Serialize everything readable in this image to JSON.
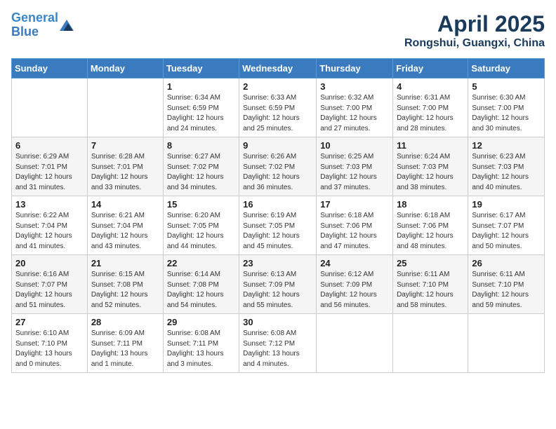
{
  "header": {
    "logo_line1": "General",
    "logo_line2": "Blue",
    "month_title": "April 2025",
    "location": "Rongshui, Guangxi, China"
  },
  "weekdays": [
    "Sunday",
    "Monday",
    "Tuesday",
    "Wednesday",
    "Thursday",
    "Friday",
    "Saturday"
  ],
  "weeks": [
    [
      {
        "day": "",
        "content": ""
      },
      {
        "day": "",
        "content": ""
      },
      {
        "day": "1",
        "content": "Sunrise: 6:34 AM\nSunset: 6:59 PM\nDaylight: 12 hours and 24 minutes."
      },
      {
        "day": "2",
        "content": "Sunrise: 6:33 AM\nSunset: 6:59 PM\nDaylight: 12 hours and 25 minutes."
      },
      {
        "day": "3",
        "content": "Sunrise: 6:32 AM\nSunset: 7:00 PM\nDaylight: 12 hours and 27 minutes."
      },
      {
        "day": "4",
        "content": "Sunrise: 6:31 AM\nSunset: 7:00 PM\nDaylight: 12 hours and 28 minutes."
      },
      {
        "day": "5",
        "content": "Sunrise: 6:30 AM\nSunset: 7:00 PM\nDaylight: 12 hours and 30 minutes."
      }
    ],
    [
      {
        "day": "6",
        "content": "Sunrise: 6:29 AM\nSunset: 7:01 PM\nDaylight: 12 hours and 31 minutes."
      },
      {
        "day": "7",
        "content": "Sunrise: 6:28 AM\nSunset: 7:01 PM\nDaylight: 12 hours and 33 minutes."
      },
      {
        "day": "8",
        "content": "Sunrise: 6:27 AM\nSunset: 7:02 PM\nDaylight: 12 hours and 34 minutes."
      },
      {
        "day": "9",
        "content": "Sunrise: 6:26 AM\nSunset: 7:02 PM\nDaylight: 12 hours and 36 minutes."
      },
      {
        "day": "10",
        "content": "Sunrise: 6:25 AM\nSunset: 7:03 PM\nDaylight: 12 hours and 37 minutes."
      },
      {
        "day": "11",
        "content": "Sunrise: 6:24 AM\nSunset: 7:03 PM\nDaylight: 12 hours and 38 minutes."
      },
      {
        "day": "12",
        "content": "Sunrise: 6:23 AM\nSunset: 7:03 PM\nDaylight: 12 hours and 40 minutes."
      }
    ],
    [
      {
        "day": "13",
        "content": "Sunrise: 6:22 AM\nSunset: 7:04 PM\nDaylight: 12 hours and 41 minutes."
      },
      {
        "day": "14",
        "content": "Sunrise: 6:21 AM\nSunset: 7:04 PM\nDaylight: 12 hours and 43 minutes."
      },
      {
        "day": "15",
        "content": "Sunrise: 6:20 AM\nSunset: 7:05 PM\nDaylight: 12 hours and 44 minutes."
      },
      {
        "day": "16",
        "content": "Sunrise: 6:19 AM\nSunset: 7:05 PM\nDaylight: 12 hours and 45 minutes."
      },
      {
        "day": "17",
        "content": "Sunrise: 6:18 AM\nSunset: 7:06 PM\nDaylight: 12 hours and 47 minutes."
      },
      {
        "day": "18",
        "content": "Sunrise: 6:18 AM\nSunset: 7:06 PM\nDaylight: 12 hours and 48 minutes."
      },
      {
        "day": "19",
        "content": "Sunrise: 6:17 AM\nSunset: 7:07 PM\nDaylight: 12 hours and 50 minutes."
      }
    ],
    [
      {
        "day": "20",
        "content": "Sunrise: 6:16 AM\nSunset: 7:07 PM\nDaylight: 12 hours and 51 minutes."
      },
      {
        "day": "21",
        "content": "Sunrise: 6:15 AM\nSunset: 7:08 PM\nDaylight: 12 hours and 52 minutes."
      },
      {
        "day": "22",
        "content": "Sunrise: 6:14 AM\nSunset: 7:08 PM\nDaylight: 12 hours and 54 minutes."
      },
      {
        "day": "23",
        "content": "Sunrise: 6:13 AM\nSunset: 7:09 PM\nDaylight: 12 hours and 55 minutes."
      },
      {
        "day": "24",
        "content": "Sunrise: 6:12 AM\nSunset: 7:09 PM\nDaylight: 12 hours and 56 minutes."
      },
      {
        "day": "25",
        "content": "Sunrise: 6:11 AM\nSunset: 7:10 PM\nDaylight: 12 hours and 58 minutes."
      },
      {
        "day": "26",
        "content": "Sunrise: 6:11 AM\nSunset: 7:10 PM\nDaylight: 12 hours and 59 minutes."
      }
    ],
    [
      {
        "day": "27",
        "content": "Sunrise: 6:10 AM\nSunset: 7:10 PM\nDaylight: 13 hours and 0 minutes."
      },
      {
        "day": "28",
        "content": "Sunrise: 6:09 AM\nSunset: 7:11 PM\nDaylight: 13 hours and 1 minute."
      },
      {
        "day": "29",
        "content": "Sunrise: 6:08 AM\nSunset: 7:11 PM\nDaylight: 13 hours and 3 minutes."
      },
      {
        "day": "30",
        "content": "Sunrise: 6:08 AM\nSunset: 7:12 PM\nDaylight: 13 hours and 4 minutes."
      },
      {
        "day": "",
        "content": ""
      },
      {
        "day": "",
        "content": ""
      },
      {
        "day": "",
        "content": ""
      }
    ]
  ]
}
